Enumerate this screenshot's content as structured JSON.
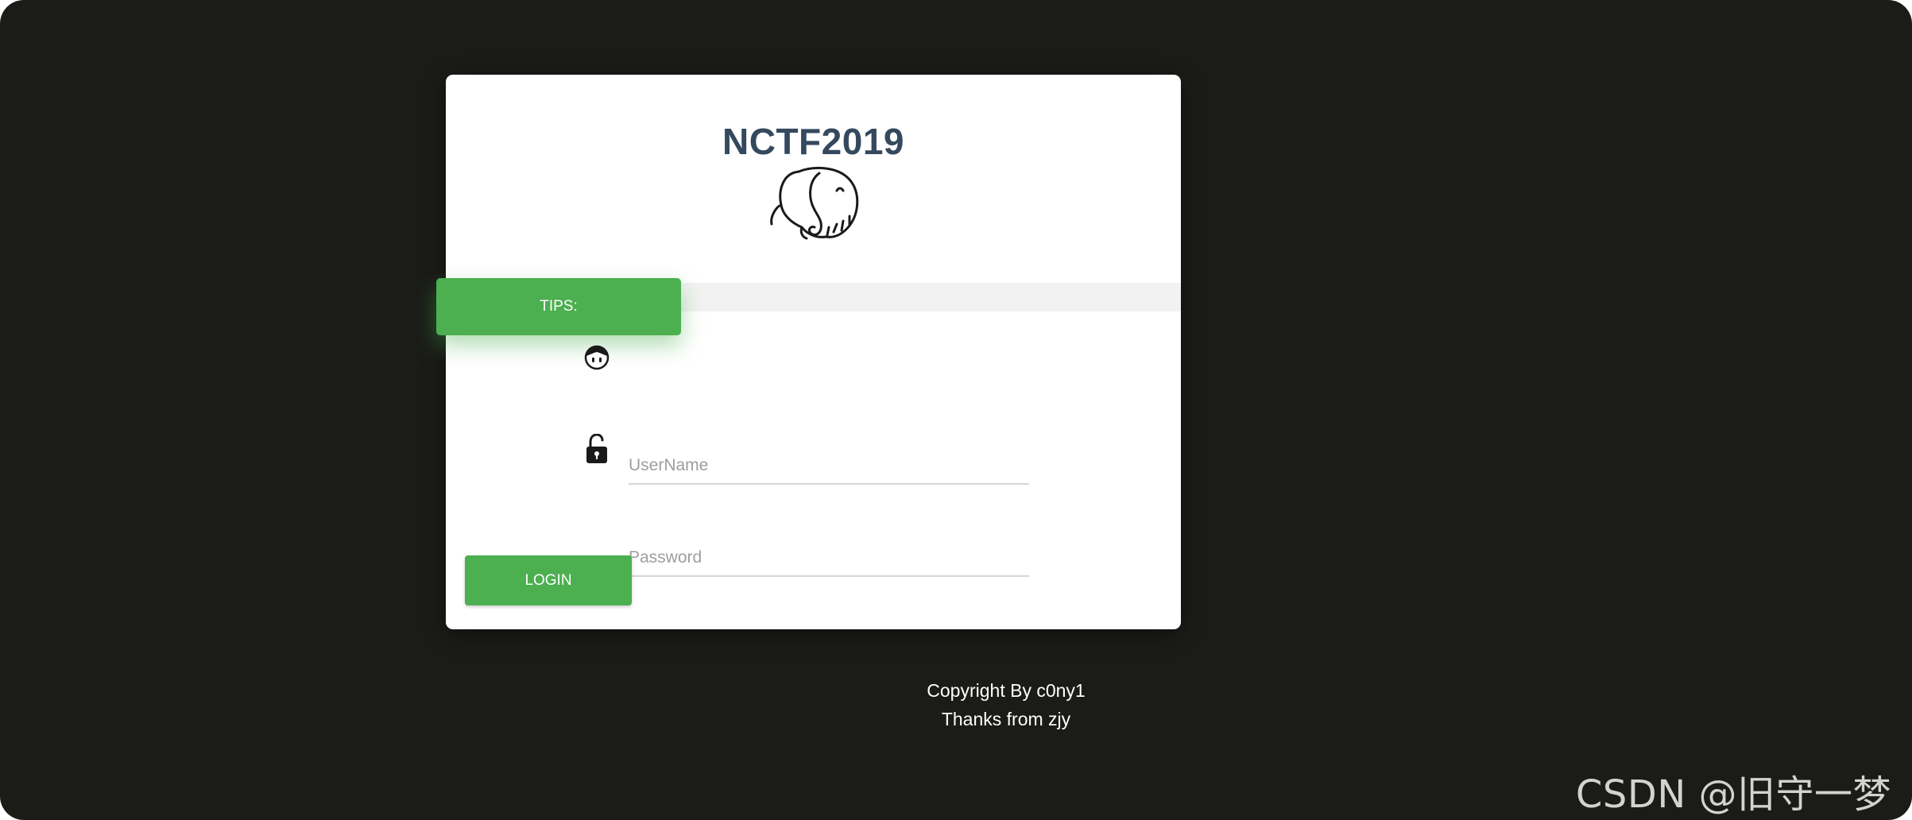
{
  "login_card": {
    "title": "NCTF2019",
    "logo_icon": "elephant-icon",
    "tips_label": "TIPS:",
    "username": {
      "icon": "user-face-icon",
      "value": "",
      "placeholder": "UserName"
    },
    "password": {
      "icon": "unlock-icon",
      "value": "",
      "placeholder": "Password"
    },
    "login_label": "LOGIN"
  },
  "footer": {
    "copyright": "Copyright By c0ny1",
    "thanks": "Thanks from zjy"
  },
  "watermark": "CSDN @旧守一梦",
  "colors": {
    "background": "#1b1c18",
    "card": "#ffffff",
    "accent_green": "#4caf50",
    "title": "#34495e"
  }
}
